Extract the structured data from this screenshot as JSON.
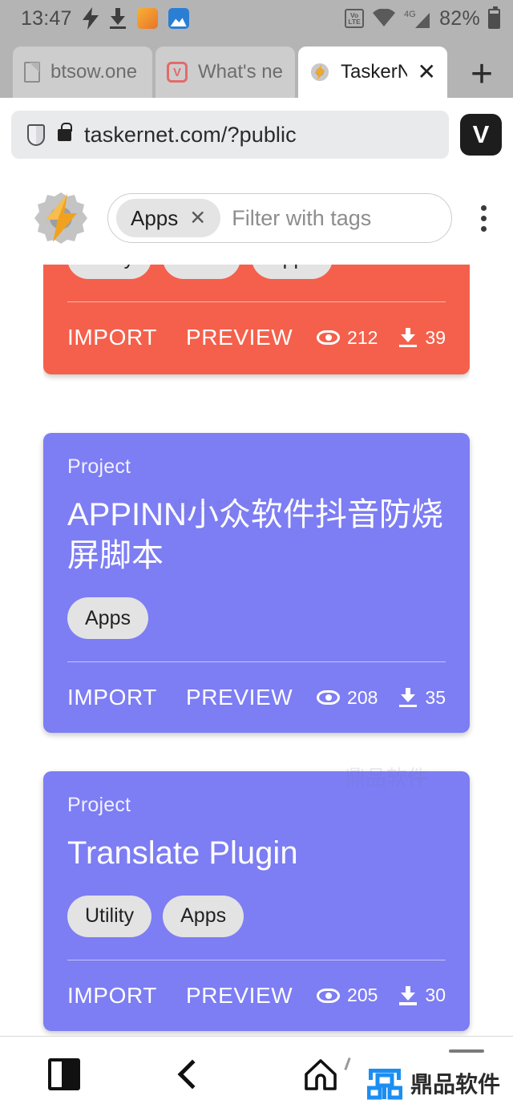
{
  "status_bar": {
    "time": "13:47",
    "battery_percent": "82%",
    "network_type": "4G",
    "volte_top": "Vo",
    "volte_bottom": "LTE",
    "icons": [
      "flash-icon",
      "download-icon",
      "orange-app-icon",
      "blue-app-icon",
      "volte-icon",
      "wifi-icon",
      "signal-icon",
      "battery-icon"
    ]
  },
  "browser": {
    "tabs": [
      {
        "title": "btsow.one",
        "favicon": "document-icon",
        "active": false
      },
      {
        "title": "What's ne",
        "favicon": "vivaldi-icon",
        "active": false
      },
      {
        "title": "TaskerN",
        "favicon": "tasker-gear-icon",
        "active": true,
        "close_label": "✕"
      }
    ],
    "new_tab_label": "+",
    "address": {
      "url": "taskernet.com/?public",
      "shield_icon": "shield-icon",
      "lock_icon": "lock-icon"
    },
    "vivaldi_button_label": "V"
  },
  "taskernet": {
    "logo": "tasker-gear-lightning-logo",
    "filter": {
      "selected_tag": "Apps",
      "remove_tag_label": "✕",
      "placeholder": "Filter with tags"
    },
    "overflow_menu": "kebab-menu-icon",
    "cards": [
      {
        "id": "card-clipped-orange",
        "color": "#f4604b",
        "label": "",
        "title": "",
        "tags": [
          "Utility",
          "Root",
          "Apps"
        ],
        "import_label": "IMPORT",
        "preview_label": "PREVIEW",
        "views": "212",
        "downloads": "39"
      },
      {
        "id": "card-appinn",
        "color": "#7d7df4",
        "label": "Project",
        "title": "APPINN小众软件抖音防烧屏脚本",
        "tags": [
          "Apps"
        ],
        "import_label": "IMPORT",
        "preview_label": "PREVIEW",
        "views": "208",
        "downloads": "35"
      },
      {
        "id": "card-translate-plugin",
        "color": "#7d7df4",
        "label": "Project",
        "title": "Translate Plugin",
        "tags": [
          "Utility",
          "Apps"
        ],
        "import_label": "IMPORT",
        "preview_label": "PREVIEW",
        "views": "205",
        "downloads": "30"
      }
    ]
  },
  "nav_bar": {
    "recents_label": "recents-icon",
    "back_label": "back-icon",
    "home_label": "home-icon"
  },
  "watermark": {
    "brand_text": "鼎品软件",
    "brand_color": "#1b8ef2",
    "overlay_text": "鼎品软件"
  }
}
